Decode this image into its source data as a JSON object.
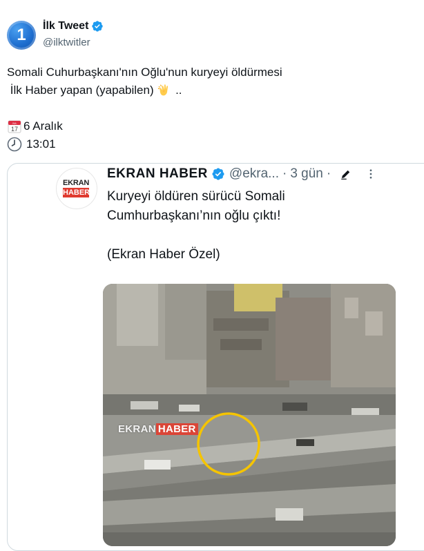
{
  "tweet": {
    "author": {
      "avatar_text": "1",
      "name": "İlk Tweet",
      "handle": "@ilktwitler",
      "verified": true
    },
    "text_line1": "Somali Cuhurbaşkanı'nın Oğlu'nun kuryeyi öldürmesi",
    "text_line2": " İlk Haber yapan (yapabilen)",
    "text_line2_suffix": " ..",
    "date_text": "6 Aralık",
    "time_text": "13:01",
    "calendar_icon_text": "17"
  },
  "embed": {
    "logo_top": "EKRAN",
    "logo_bottom": "HABER",
    "name": "EKRAN HABER",
    "handle": "@ekra...",
    "separator": "·",
    "time": "3 gün",
    "text_line1": "Kuryeyi öldüren sürücü Somali",
    "text_line2": "Cumhurbaşkanı’nın oğlu çıktı!",
    "text_line3": "(Ekran Haber Özel)",
    "video_watermark_a": "EKRAN",
    "video_watermark_b": "HABER"
  },
  "colors": {
    "verified": "#1d9bf0",
    "secondary_text": "#536471",
    "border": "#cfd9de",
    "highlight_circle": "#f5c400",
    "brand_red": "#e03a2f"
  }
}
